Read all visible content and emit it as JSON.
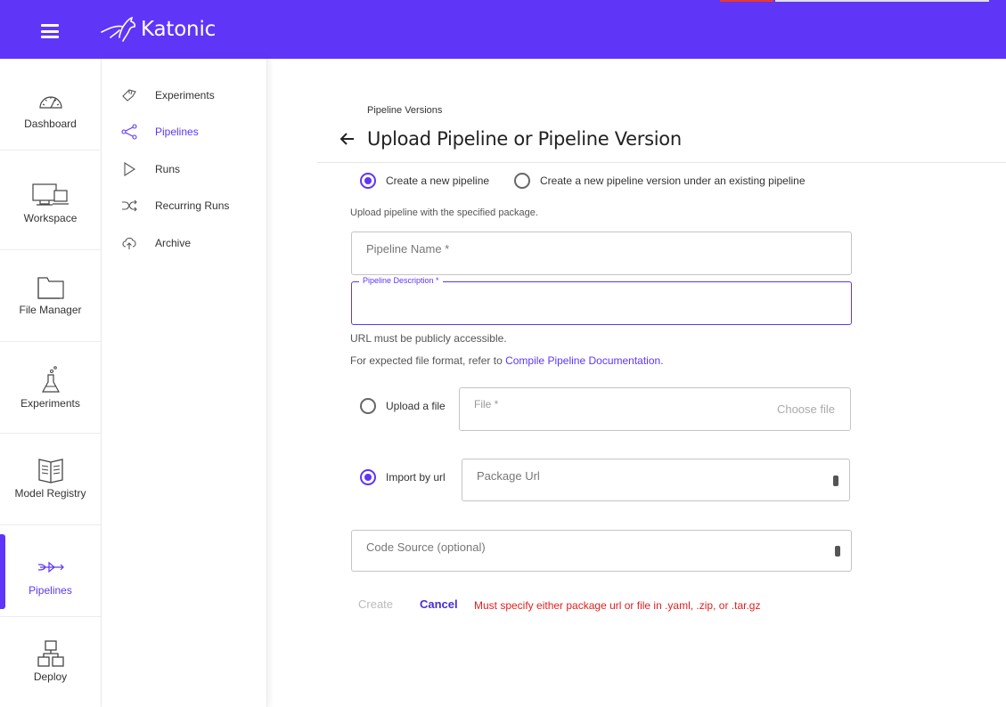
{
  "app": {
    "brand": "Katonic",
    "colors": {
      "brand": "#5f35f8",
      "error": "#e02020"
    }
  },
  "leftnav": {
    "items": [
      {
        "label": "Dashboard",
        "icon": "gauge-icon"
      },
      {
        "label": "Workspace",
        "icon": "monitor-icon"
      },
      {
        "label": "File Manager",
        "icon": "folder-icon"
      },
      {
        "label": "Experiments",
        "icon": "flask-icon"
      },
      {
        "label": "Model Registry",
        "icon": "book-icon"
      },
      {
        "label": "Pipelines",
        "icon": "pipeline-icon",
        "active": true
      },
      {
        "label": "Deploy",
        "icon": "hierarchy-icon"
      }
    ]
  },
  "subnav": {
    "items": [
      {
        "label": "Experiments",
        "icon": "experiments-icon"
      },
      {
        "label": "Pipelines",
        "icon": "share-nodes-icon",
        "active": true
      },
      {
        "label": "Runs",
        "icon": "play-icon"
      },
      {
        "label": "Recurring Runs",
        "icon": "shuffle-icon"
      },
      {
        "label": "Archive",
        "icon": "cloud-upload-icon"
      }
    ]
  },
  "main": {
    "breadcrumb": "Pipeline Versions",
    "title": "Upload Pipeline or Pipeline Version",
    "mode_options": [
      {
        "label": "Create a new pipeline",
        "checked": true
      },
      {
        "label": "Create a new pipeline version under an existing pipeline",
        "checked": false
      }
    ],
    "upload_hint": "Upload pipeline with the specified package.",
    "pipeline_name": {
      "placeholder": "Pipeline Name *",
      "value": ""
    },
    "pipeline_description": {
      "label": "Pipeline Description *",
      "value": ""
    },
    "url_note": "URL must be publicly accessible.",
    "format_note_prefix": "For expected file format, refer to",
    "format_link": "Compile Pipeline Documentation",
    "format_note_suffix": ".",
    "source_options": [
      {
        "label": "Upload a file",
        "checked": false
      },
      {
        "label": "Import by url",
        "checked": true
      }
    ],
    "file_field": {
      "placeholder": "File *",
      "action": "Choose file"
    },
    "package_url": {
      "placeholder": "Package Url",
      "value": ""
    },
    "code_source": {
      "placeholder": "Code Source (optional)",
      "value": ""
    },
    "actions": {
      "create": "Create",
      "cancel": "Cancel"
    },
    "error": "Must specify either package url or file in .yaml, .zip, or .tar.gz"
  }
}
